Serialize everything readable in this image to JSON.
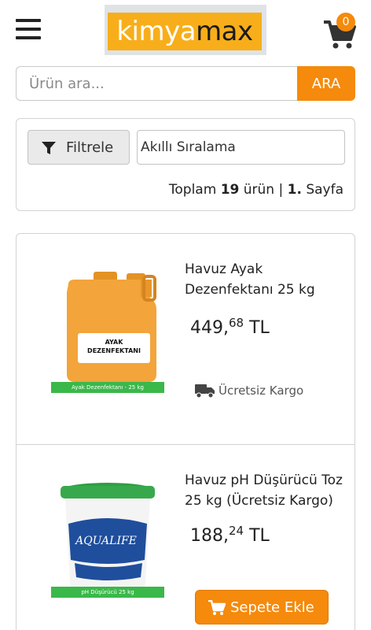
{
  "header": {
    "logo_left": "kimya",
    "logo_right": "max",
    "cart_count": "0"
  },
  "search": {
    "placeholder": "Ürün ara...",
    "button": "ARA"
  },
  "filters": {
    "filter_label": "Filtrele",
    "sort_selected": "Akıllı Sıralama",
    "summary_prefix": "Toplam",
    "total_count": "19",
    "count_unit": "ürün |",
    "page_number": "1.",
    "page_label": "Sayfa"
  },
  "products": [
    {
      "title": "Havuz Ayak Dezenfektanı 25 kg",
      "price_int": "449,",
      "price_dec": "68",
      "currency": "TL",
      "image_label": "Ayak Dezenfektanı - 25 kg",
      "drum_label_line1": "AYAK",
      "drum_label_line2": "DEZENFEKTANI",
      "shipping": "Ücretsiz Kargo"
    },
    {
      "title": "Havuz pH Düşürücü Toz 25 kg (Ücretsiz Kargo)",
      "price_int": "188,",
      "price_dec": "24",
      "currency": "TL",
      "image_label": "pH Düşürücü 25 kg",
      "brand_text": "AQUALIFE",
      "add_to_cart": "Sepete Ekle"
    }
  ],
  "colors": {
    "accent": "#f58a0c",
    "logo_bg": "#f8ae1a",
    "product_band": "#3ab84a"
  }
}
